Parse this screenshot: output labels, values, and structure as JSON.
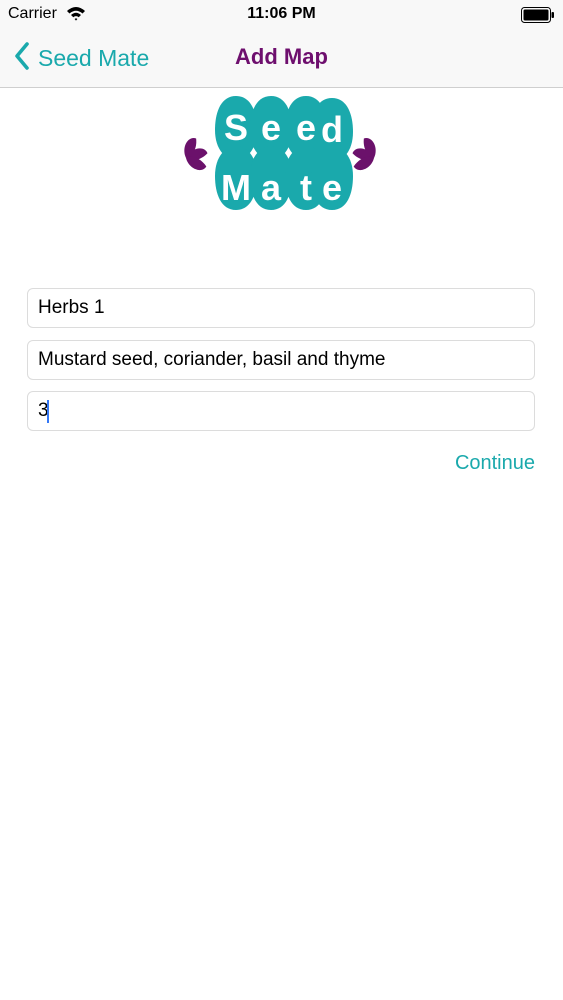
{
  "colors": {
    "accent": "#1aa9ac",
    "title": "#6e0f6e",
    "logo_leaf": "#6b116b",
    "cursor": "#3478f6"
  },
  "status_bar": {
    "carrier": "Carrier",
    "time": "11:06 PM",
    "icons": [
      "wifi-icon",
      "battery-icon"
    ]
  },
  "nav": {
    "back_label": "Seed Mate",
    "back_icon": "chevron-left-icon",
    "title": "Add Map"
  },
  "logo": {
    "line1": [
      "S",
      "e",
      "e",
      "d"
    ],
    "line2": [
      "M",
      "a",
      "t",
      "e"
    ]
  },
  "form": {
    "name_value": "Herbs 1",
    "description_value": "Mustard seed, coriander, basil and thyme",
    "size_value": "3",
    "continue_label": "Continue"
  }
}
